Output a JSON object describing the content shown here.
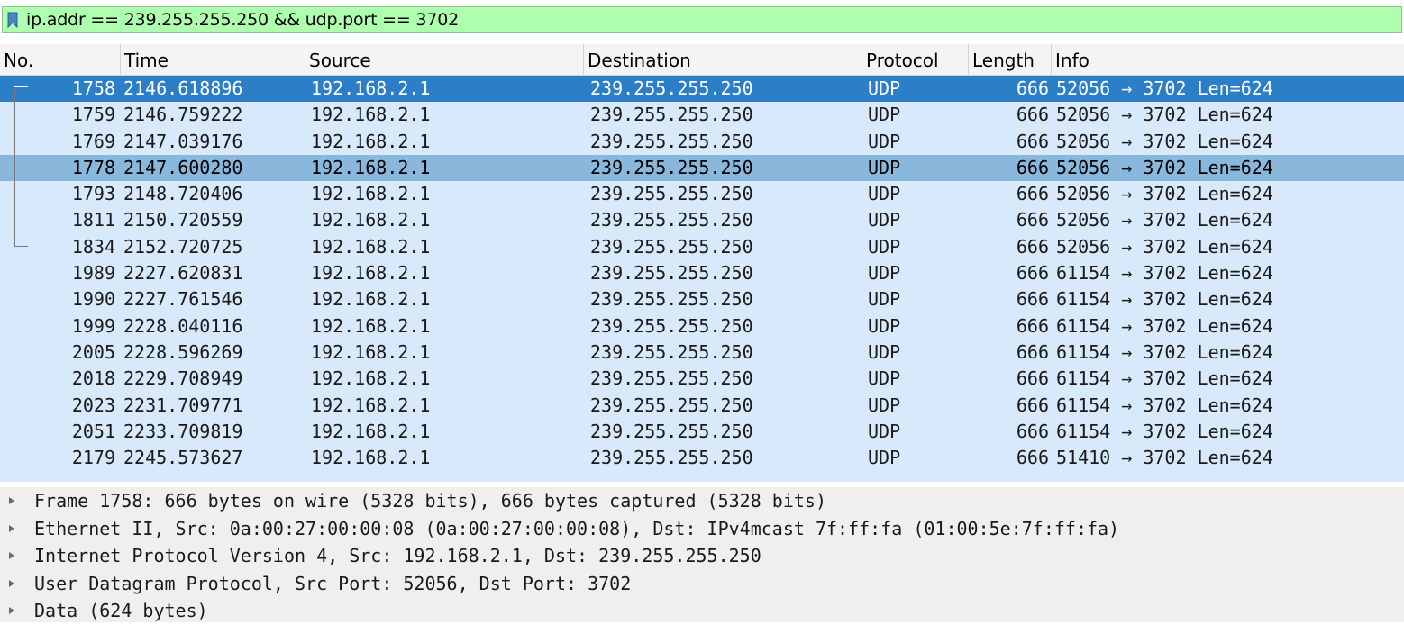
{
  "filter": {
    "text": "ip.addr == 239.255.255.250 && udp.port == 3702",
    "bookmark_icon": "bookmark-icon",
    "background_color": "#aeffae"
  },
  "columns": [
    "No.",
    "Time",
    "Source",
    "Destination",
    "Protocol",
    "Length",
    "Info"
  ],
  "rows": [
    {
      "no": "1758",
      "time": "2146.618896",
      "source": "192.168.2.1",
      "destination": "239.255.255.250",
      "protocol": "UDP",
      "length": "666",
      "info": "52056 → 3702 Len=624"
    },
    {
      "no": "1759",
      "time": "2146.759222",
      "source": "192.168.2.1",
      "destination": "239.255.255.250",
      "protocol": "UDP",
      "length": "666",
      "info": "52056 → 3702 Len=624"
    },
    {
      "no": "1769",
      "time": "2147.039176",
      "source": "192.168.2.1",
      "destination": "239.255.255.250",
      "protocol": "UDP",
      "length": "666",
      "info": "52056 → 3702 Len=624"
    },
    {
      "no": "1778",
      "time": "2147.600280",
      "source": "192.168.2.1",
      "destination": "239.255.255.250",
      "protocol": "UDP",
      "length": "666",
      "info": "52056 → 3702 Len=624"
    },
    {
      "no": "1793",
      "time": "2148.720406",
      "source": "192.168.2.1",
      "destination": "239.255.255.250",
      "protocol": "UDP",
      "length": "666",
      "info": "52056 → 3702 Len=624"
    },
    {
      "no": "1811",
      "time": "2150.720559",
      "source": "192.168.2.1",
      "destination": "239.255.255.250",
      "protocol": "UDP",
      "length": "666",
      "info": "52056 → 3702 Len=624"
    },
    {
      "no": "1834",
      "time": "2152.720725",
      "source": "192.168.2.1",
      "destination": "239.255.255.250",
      "protocol": "UDP",
      "length": "666",
      "info": "52056 → 3702 Len=624"
    },
    {
      "no": "1989",
      "time": "2227.620831",
      "source": "192.168.2.1",
      "destination": "239.255.255.250",
      "protocol": "UDP",
      "length": "666",
      "info": "61154 → 3702 Len=624"
    },
    {
      "no": "1990",
      "time": "2227.761546",
      "source": "192.168.2.1",
      "destination": "239.255.255.250",
      "protocol": "UDP",
      "length": "666",
      "info": "61154 → 3702 Len=624"
    },
    {
      "no": "1999",
      "time": "2228.040116",
      "source": "192.168.2.1",
      "destination": "239.255.255.250",
      "protocol": "UDP",
      "length": "666",
      "info": "61154 → 3702 Len=624"
    },
    {
      "no": "2005",
      "time": "2228.596269",
      "source": "192.168.2.1",
      "destination": "239.255.255.250",
      "protocol": "UDP",
      "length": "666",
      "info": "61154 → 3702 Len=624"
    },
    {
      "no": "2018",
      "time": "2229.708949",
      "source": "192.168.2.1",
      "destination": "239.255.255.250",
      "protocol": "UDP",
      "length": "666",
      "info": "61154 → 3702 Len=624"
    },
    {
      "no": "2023",
      "time": "2231.709771",
      "source": "192.168.2.1",
      "destination": "239.255.255.250",
      "protocol": "UDP",
      "length": "666",
      "info": "61154 → 3702 Len=624"
    },
    {
      "no": "2051",
      "time": "2233.709819",
      "source": "192.168.2.1",
      "destination": "239.255.255.250",
      "protocol": "UDP",
      "length": "666",
      "info": "61154 → 3702 Len=624"
    },
    {
      "no": "2179",
      "time": "2245.573627",
      "source": "192.168.2.1",
      "destination": "239.255.255.250",
      "protocol": "UDP",
      "length": "666",
      "info": "51410 → 3702 Len=624"
    }
  ],
  "selected_row_color": "#2c7fc6",
  "highlight_row_color": "#8ab8dc",
  "details": [
    "Frame 1758: 666 bytes on wire (5328 bits), 666 bytes captured (5328 bits)",
    "Ethernet II, Src: 0a:00:27:00:00:08 (0a:00:27:00:00:08), Dst: IPv4mcast_7f:ff:fa (01:00:5e:7f:ff:fa)",
    "Internet Protocol Version 4, Src: 192.168.2.1, Dst: 239.255.255.250",
    "User Datagram Protocol, Src Port: 52056, Dst Port: 3702",
    "Data (624 bytes)"
  ]
}
